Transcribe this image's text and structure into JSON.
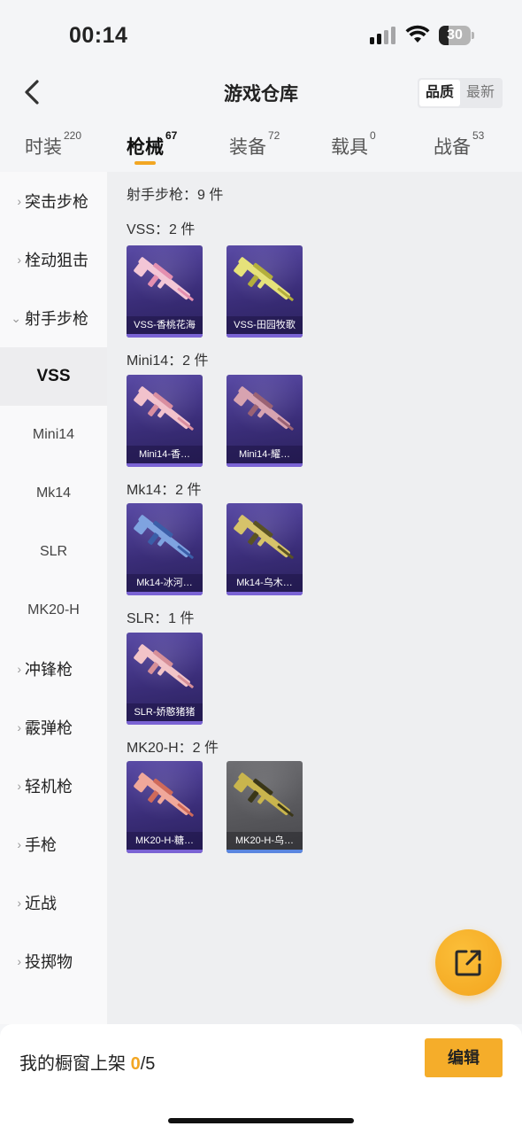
{
  "status_bar": {
    "time": "00:14",
    "battery": "30"
  },
  "nav": {
    "title": "游戏仓库",
    "sort_options": [
      "品质",
      "最新"
    ],
    "sort_active": "品质"
  },
  "category_tabs": [
    {
      "label": "时装",
      "count": "220"
    },
    {
      "label": "枪械",
      "count": "67"
    },
    {
      "label": "装备",
      "count": "72"
    },
    {
      "label": "载具",
      "count": "0"
    },
    {
      "label": "战备",
      "count": "53"
    }
  ],
  "active_tab": "枪械",
  "side_nav": [
    {
      "label": "突击步枪",
      "chevron": "›"
    },
    {
      "label": "栓动狙击",
      "chevron": "›"
    },
    {
      "label": "射手步枪",
      "chevron": "⌄"
    },
    {
      "label": "VSS"
    },
    {
      "label": "Mini14"
    },
    {
      "label": "Mk14"
    },
    {
      "label": "SLR"
    },
    {
      "label": "MK20-H"
    },
    {
      "label": "冲锋枪",
      "chevron": "›"
    },
    {
      "label": "霰弹枪",
      "chevron": "›"
    },
    {
      "label": "轻机枪",
      "chevron": "›"
    },
    {
      "label": "手枪",
      "chevron": "›"
    },
    {
      "label": "近战",
      "chevron": "›"
    },
    {
      "label": "投掷物",
      "chevron": "›"
    }
  ],
  "section_header": "射手步枪：9 件",
  "groups": [
    {
      "title": "VSS：2 件",
      "items": [
        {
          "name": "VSS-香桃花海",
          "colors": [
            "#f3c6d6",
            "#e48fb0"
          ],
          "quality": "purple"
        },
        {
          "name": "VSS-田园牧歌",
          "colors": [
            "#e6e27a",
            "#b4ae3c"
          ],
          "quality": "purple"
        }
      ]
    },
    {
      "title": "Mini14：2 件",
      "items": [
        {
          "name": "Mini14-香…",
          "colors": [
            "#f2c2cc",
            "#d98ea0"
          ],
          "quality": "purple"
        },
        {
          "name": "Mini14-耀…",
          "colors": [
            "#d7a3b0",
            "#9a6274"
          ],
          "quality": "purple"
        }
      ]
    },
    {
      "title": "Mk14：2 件",
      "items": [
        {
          "name": "Mk14-冰河…",
          "colors": [
            "#7fa3e0",
            "#3b5ea8"
          ],
          "quality": "purple"
        },
        {
          "name": "Mk14-乌木…",
          "colors": [
            "#d6c36a",
            "#5a5224"
          ],
          "quality": "purple"
        }
      ]
    },
    {
      "title": "SLR：1 件",
      "items": [
        {
          "name": "SLR-娇憨猪猪",
          "colors": [
            "#f2c4c8",
            "#d68f98"
          ],
          "quality": "purple"
        }
      ]
    },
    {
      "title": "MK20-H：2 件",
      "items": [
        {
          "name": "MK20-H-糖…",
          "colors": [
            "#f0a89a",
            "#cf6a5a"
          ],
          "quality": "purple"
        },
        {
          "name": "MK20-H-乌…",
          "colors": [
            "#c9b54d",
            "#3a3618"
          ],
          "quality": "gray"
        }
      ]
    }
  ],
  "shelf": {
    "label": "我的橱窗上架",
    "current": "0",
    "total": "/5"
  },
  "edit_button": "编辑",
  "icons": {
    "back": "chevron-left-icon",
    "fab": "share-external-icon"
  }
}
